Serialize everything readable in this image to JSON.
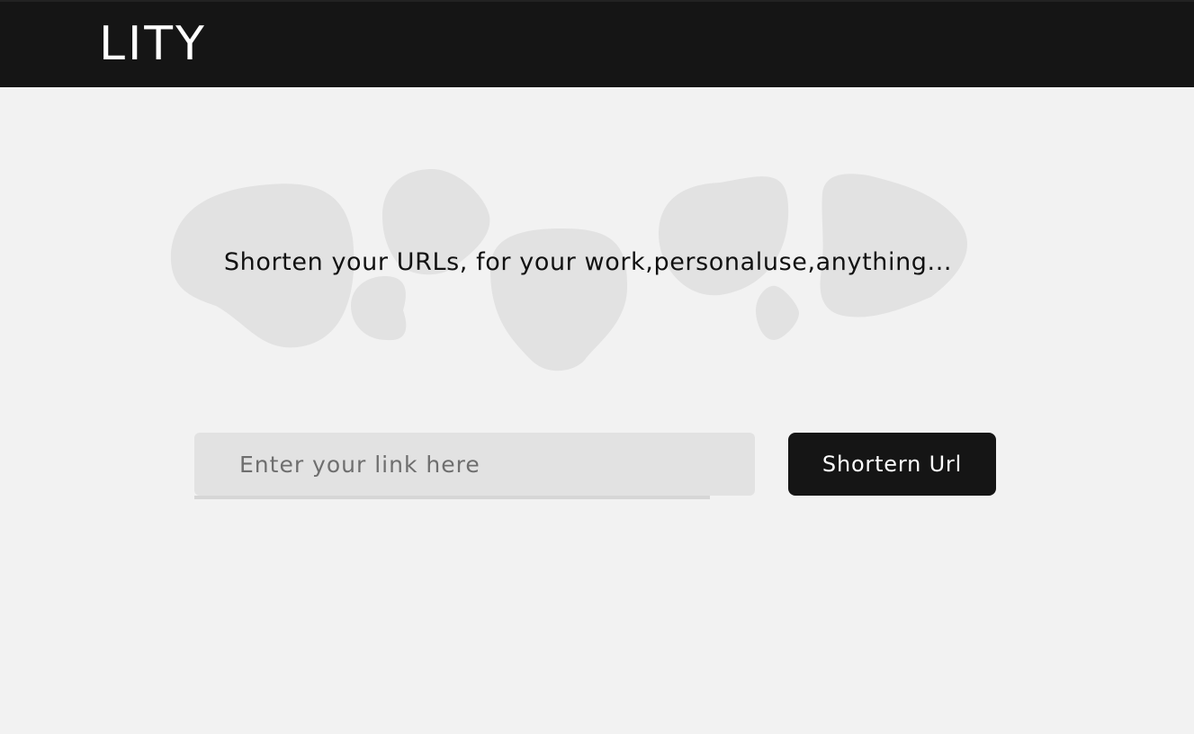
{
  "header": {
    "logo_text": "LITY"
  },
  "hero": {
    "tagline": "Shorten your URLs, for your work,personaluse,anything..."
  },
  "form": {
    "input_placeholder": "Enter your link here",
    "input_value": "",
    "submit_label": "Shortern Url"
  },
  "colors": {
    "navbar_bg": "#151515",
    "page_bg": "#f2f2f2",
    "blob_fill": "#e2e2e2",
    "input_bg": "#e2e2e2",
    "button_bg": "#151515",
    "button_text": "#ffffff"
  }
}
